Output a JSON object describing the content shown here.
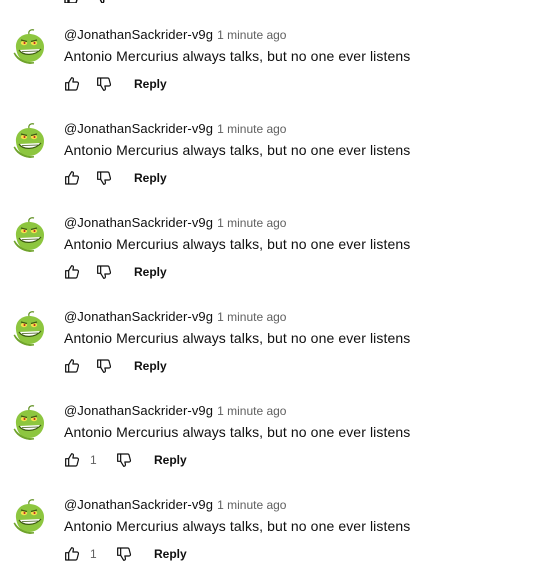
{
  "comments": [
    {
      "author": "@JonathanSackrider-v9g",
      "time": "1 minute ago",
      "text": "Antonio Mercurius always talks, but no one ever listens",
      "likes": "",
      "reply_label": "Reply"
    },
    {
      "author": "@JonathanSackrider-v9g",
      "time": "1 minute ago",
      "text": "Antonio Mercurius always talks, but no one ever listens",
      "likes": "",
      "reply_label": "Reply"
    },
    {
      "author": "@JonathanSackrider-v9g",
      "time": "1 minute ago",
      "text": "Antonio Mercurius always talks, but no one ever listens",
      "likes": "",
      "reply_label": "Reply"
    },
    {
      "author": "@JonathanSackrider-v9g",
      "time": "1 minute ago",
      "text": "Antonio Mercurius always talks, but no one ever listens",
      "likes": "",
      "reply_label": "Reply"
    },
    {
      "author": "@JonathanSackrider-v9g",
      "time": "1 minute ago",
      "text": "Antonio Mercurius always talks, but no one ever listens",
      "likes": "1",
      "reply_label": "Reply"
    },
    {
      "author": "@JonathanSackrider-v9g",
      "time": "1 minute ago",
      "text": "Antonio Mercurius always talks, but no one ever listens",
      "likes": "1",
      "reply_label": "Reply"
    }
  ],
  "icons": {
    "avatar": "grinch-avatar-icon",
    "like": "thumbs-up-icon",
    "dislike": "thumbs-down-icon"
  },
  "colors": {
    "text": "#0f0f0f",
    "secondary_text": "#606060",
    "avatar_green": "#8dc63f"
  }
}
